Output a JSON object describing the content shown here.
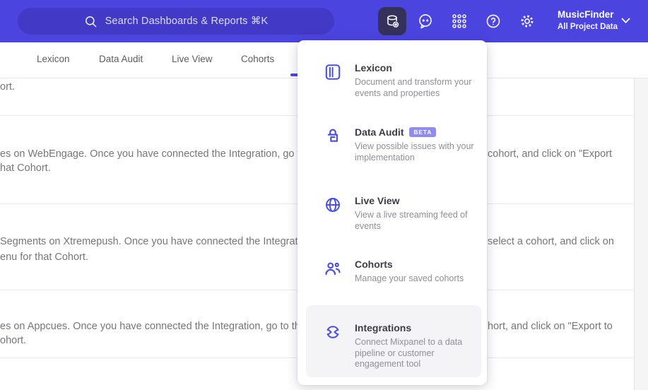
{
  "colors": {
    "topbar": "#4B44DF",
    "search_field": "#4239C6",
    "active_nav_button_bg": "#34325A",
    "accent_underline": "#4B44DF",
    "menu_icon": "#4B4FE3",
    "beta_badge": "#8F8BEF",
    "row_highlight": "#F4F4F6"
  },
  "icons": {
    "search-icon": "magnifier",
    "data-management-icon": "database-with-gear",
    "feedback-icon": "smiley-speech-bubble",
    "apps-grid-icon": "3x3-dot-grid",
    "help-icon": "question-mark-circle",
    "settings-icon": "gear",
    "chevron-down-icon": "chevron-down",
    "lexicon-icon": "book",
    "data-audit-icon": "lock-spiral",
    "live-view-icon": "globe",
    "cohorts-icon": "two-people",
    "integrations-icon": "circular-sync-arrows"
  },
  "topbar": {
    "search": {
      "placeholder": "Search Dashboards & Reports ⌘K"
    },
    "project": {
      "name": "MusicFinder",
      "scope": "All Project Data"
    }
  },
  "tabs": [
    {
      "label": "Lexicon"
    },
    {
      "label": "Data Audit"
    },
    {
      "label": "Live View"
    },
    {
      "label": "Cohorts"
    }
  ],
  "menu": {
    "items": [
      {
        "title": "Lexicon",
        "desc": "Document and transform your events and properties"
      },
      {
        "title": "Data Audit",
        "badge": "BETA",
        "desc": "View possible issues with your implementation"
      },
      {
        "title": "Live View",
        "desc": "View a live streaming feed of events"
      },
      {
        "title": "Cohorts",
        "desc": "Manage your saved cohorts"
      },
      {
        "title": "Integrations",
        "desc": "Connect Mixpanel to a data pipeline or customer engagement tool",
        "highlighted": true
      }
    ]
  },
  "content": {
    "rows": [
      {
        "l1_left": "ort."
      },
      {
        "l1_left": "es on WebEngage. Once you have connected the Integration, go to the",
        "l1_right": "cohort, and click on \"Export",
        "l2": "hat Cohort."
      },
      {
        "l1_left": "Segments on Xtremepush. Once you have connected the Integration,",
        "l1_right": "select a cohort, and click on",
        "l2": "enu for that Cohort."
      },
      {
        "l1_left": "es on Appcues. Once you have connected the Integration, go to the M",
        "l1_right": "hort, and click on \"Export to",
        "l2": "ohort."
      }
    ]
  }
}
